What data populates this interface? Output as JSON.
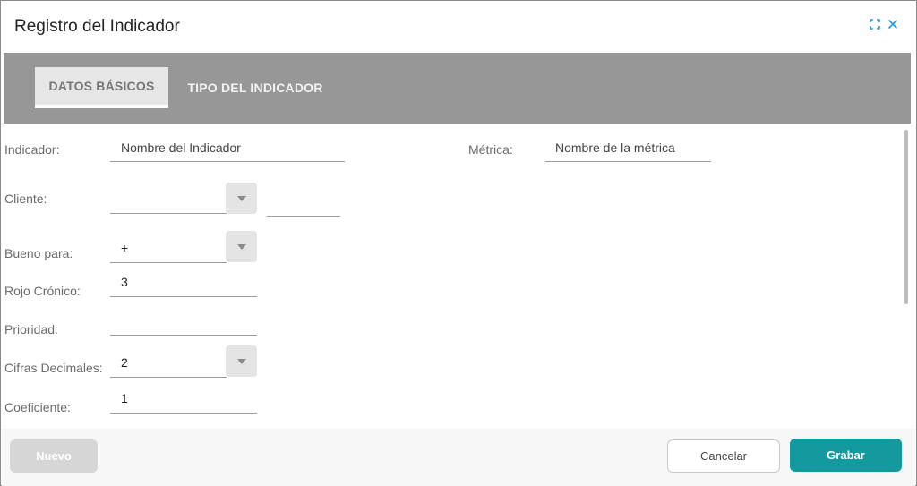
{
  "dialog": {
    "title": "Registro del Indicador"
  },
  "tabs": [
    {
      "label": "DATOS BÁSICOS",
      "active": true
    },
    {
      "label": "TIPO DEL INDICADOR",
      "active": false
    }
  ],
  "form": {
    "indicador": {
      "label": "Indicador:",
      "placeholder": "Nombre del Indicador",
      "value": ""
    },
    "metrica": {
      "label": "Métrica:",
      "placeholder": "Nombre de la métrica",
      "value": ""
    },
    "cliente": {
      "label": "Cliente:",
      "value": "",
      "extra_value": ""
    },
    "bueno_para": {
      "label": "Bueno para:",
      "value": "+"
    },
    "rojo_cronico": {
      "label": "Rojo Crónico:",
      "value": "3"
    },
    "prioridad": {
      "label": "Prioridad:",
      "value": ""
    },
    "cifras_decimales": {
      "label": "Cifras Decimales:",
      "value": "2"
    },
    "coeficiente": {
      "label": "Coeficiente:",
      "value": "1"
    }
  },
  "footer": {
    "nuevo_label": "Nuevo",
    "cancel_label": "Cancelar",
    "save_label": "Grabar"
  },
  "icons": {
    "expand": "expand-icon",
    "close": "close-icon"
  },
  "colors": {
    "accent": "#129a9e",
    "icon_blue": "#2f9be0",
    "tabbar": "#979797"
  }
}
